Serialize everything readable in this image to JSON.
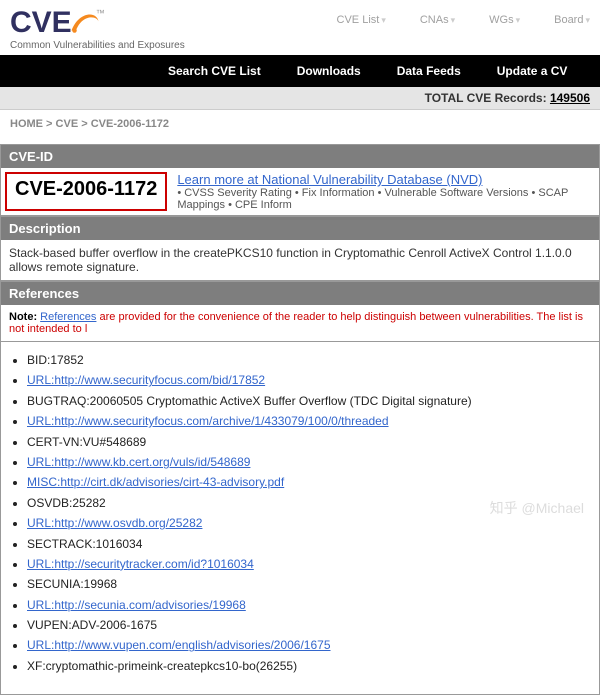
{
  "logo": {
    "text": "CVE",
    "tm": "™",
    "tagline": "Common Vulnerabilities and Exposures"
  },
  "topnav": [
    "CVE List",
    "CNAs",
    "WGs",
    "Board"
  ],
  "blackbar": [
    "Search CVE List",
    "Downloads",
    "Data Feeds",
    "Update a CV"
  ],
  "totals": {
    "label": "TOTAL CVE Records:",
    "count": "149506"
  },
  "crumbs": {
    "home": "HOME",
    "mid": "CVE",
    "leaf": "CVE-2006-1172"
  },
  "sections": {
    "cveid": "CVE-ID",
    "description": "Description",
    "references": "References"
  },
  "cve": {
    "id": "CVE-2006-1172",
    "nvd_link": "Learn more at National Vulnerability Database (NVD)",
    "nvd_meta": "• CVSS Severity Rating • Fix Information • Vulnerable Software Versions • SCAP Mappings • CPE Inform",
    "description": "Stack-based buffer overflow in the createPKCS10 function in Cryptomathic Cenroll ActiveX Control 1.1.0.0 allows remote signature."
  },
  "note": {
    "bold": "Note:",
    "link": "References",
    "rest": "are provided for the convenience of the reader to help distinguish between vulnerabilities. The list is not intended to l"
  },
  "refs": [
    {
      "text": "BID:17852",
      "link": false
    },
    {
      "text": "URL:http://www.securityfocus.com/bid/17852",
      "link": true
    },
    {
      "text": "BUGTRAQ:20060505 Cryptomathic ActiveX Buffer Overflow (TDC Digital signature)",
      "link": false
    },
    {
      "text": "URL:http://www.securityfocus.com/archive/1/433079/100/0/threaded",
      "link": true
    },
    {
      "text": "CERT-VN:VU#548689",
      "link": false
    },
    {
      "text": "URL:http://www.kb.cert.org/vuls/id/548689",
      "link": true
    },
    {
      "text": "MISC:http://cirt.dk/advisories/cirt-43-advisory.pdf",
      "link": true
    },
    {
      "text": "OSVDB:25282",
      "link": false
    },
    {
      "text": "URL:http://www.osvdb.org/25282",
      "link": true
    },
    {
      "text": "SECTRACK:1016034",
      "link": false
    },
    {
      "text": "URL:http://securitytracker.com/id?1016034",
      "link": true
    },
    {
      "text": "SECUNIA:19968",
      "link": false
    },
    {
      "text": "URL:http://secunia.com/advisories/19968",
      "link": true
    },
    {
      "text": "VUPEN:ADV-2006-1675",
      "link": false
    },
    {
      "text": "URL:http://www.vupen.com/english/advisories/2006/1675",
      "link": true
    },
    {
      "text": "XF:cryptomathic-primeink-createpkcs10-bo(26255)",
      "link": false
    }
  ],
  "watermark": "知乎 @Michael"
}
